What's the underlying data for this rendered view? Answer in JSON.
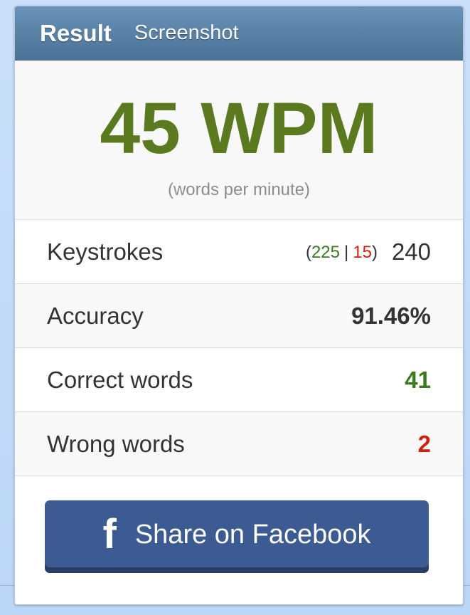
{
  "header": {
    "tabs": [
      {
        "label": "Result"
      },
      {
        "label": "Screenshot"
      }
    ]
  },
  "result": {
    "wpm": "45 WPM",
    "wpm_caption": "(words per minute)"
  },
  "stats": {
    "keystrokes": {
      "label": "Keystrokes",
      "correct": "225",
      "wrong": "15",
      "total": "240"
    },
    "accuracy": {
      "label": "Accuracy",
      "value": "91.46%"
    },
    "correct_words": {
      "label": "Correct words",
      "value": "41"
    },
    "wrong_words": {
      "label": "Wrong words",
      "value": "2"
    }
  },
  "share": {
    "icon": "facebook-icon",
    "label": "Share on Facebook"
  },
  "colors": {
    "wpm": "#5b7a1f",
    "correct": "#3a7a1c",
    "wrong": "#d0200f",
    "header": "#5a82a8",
    "facebook": "#3b5b92"
  }
}
